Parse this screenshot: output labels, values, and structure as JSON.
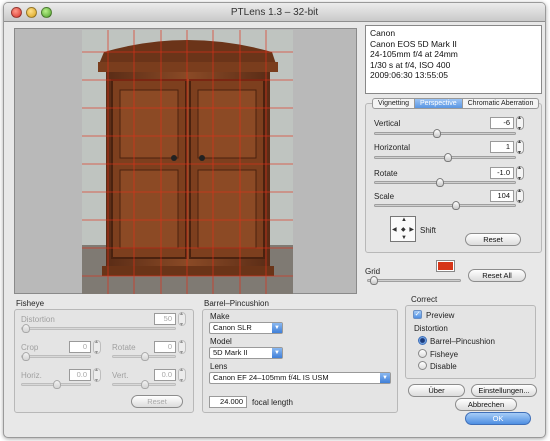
{
  "window": {
    "title": "PTLens 1.3  –  32-bit"
  },
  "info": {
    "lines": [
      "Canon",
      "Canon EOS 5D Mark II",
      "24-105mm f/4 at 24mm",
      "1/30 s at f/4, ISO 400",
      "2009:06:30 13:55:05"
    ]
  },
  "tabs": [
    "Vignetting",
    "Perspective",
    "Chromatic Aberration"
  ],
  "active_tab": "Perspective",
  "perspective": {
    "vertical": {
      "label": "Vertical",
      "value": "-6",
      "level": 0.44
    },
    "horizontal": {
      "label": "Horizontal",
      "value": "1",
      "level": 0.52
    },
    "rotate": {
      "label": "Rotate",
      "value": "-1.0",
      "level": 0.46
    },
    "scale": {
      "label": "Scale",
      "value": "104",
      "level": 0.58
    },
    "shift_label": "Shift",
    "reset_label": "Reset"
  },
  "grid": {
    "label": "Grid",
    "color": "#d63518",
    "level": 0.02,
    "reset_all_label": "Reset All"
  },
  "fisheye": {
    "title": "Fisheye",
    "distortion": {
      "label": "Distortion",
      "value": "50"
    },
    "crop": {
      "label": "Crop",
      "value": "0"
    },
    "rotate": {
      "label": "Rotate",
      "value": "0"
    },
    "horiz": {
      "label": "Horiz.",
      "value": "0.0"
    },
    "vert": {
      "label": "Vert.",
      "value": "0.0"
    },
    "reset_label": "Reset"
  },
  "barrel": {
    "title": "Barrel–Pincushion",
    "make_label": "Make",
    "make_value": "Canon SLR",
    "model_label": "Model",
    "model_value": "5D Mark II",
    "lens_label": "Lens",
    "lens_value": "Canon EF 24–105mm f/4L IS USM",
    "focal_value": "24.000",
    "focal_label": "focal length"
  },
  "correct": {
    "title": "Correct",
    "preview_label": "Preview",
    "distortion_label": "Distortion",
    "options": [
      "Barrel–Pincushion",
      "Fisheye",
      "Disable"
    ],
    "selected": "Barrel–Pincushion"
  },
  "buttons": {
    "about": "Über",
    "settings": "Einstellungen...",
    "cancel": "Abbrechen",
    "ok": "OK"
  },
  "colors": {
    "accent": "#4f8fe2",
    "grid_line": "#d63518"
  }
}
